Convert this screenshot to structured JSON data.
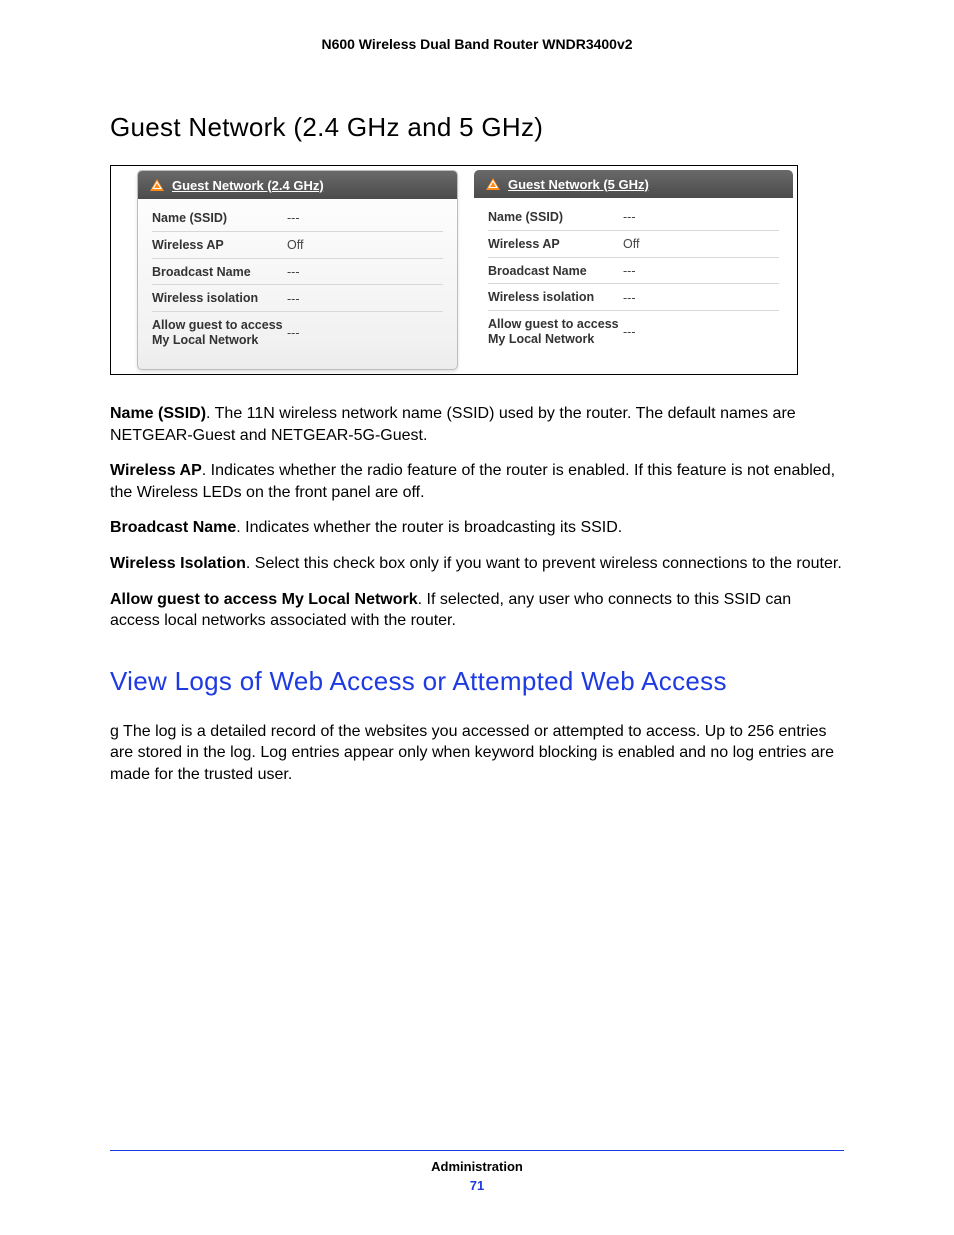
{
  "doc_header": "N600 Wireless Dual Band Router WNDR3400v2",
  "section1_title": "Guest Network (2.4 GHz and 5 GHz)",
  "panels": {
    "left": {
      "title": "Guest Network (2.4 GHz)",
      "rows": [
        {
          "k": "Name (SSID)",
          "v": "---"
        },
        {
          "k": "Wireless AP",
          "v": "Off"
        },
        {
          "k": "Broadcast Name",
          "v": "---"
        },
        {
          "k": "Wireless isolation",
          "v": "---"
        },
        {
          "k": "Allow guest to access My Local Network",
          "v": "---"
        }
      ]
    },
    "right": {
      "title": "Guest Network (5 GHz)",
      "rows": [
        {
          "k": "Name (SSID)",
          "v": "---"
        },
        {
          "k": "Wireless AP",
          "v": "Off"
        },
        {
          "k": "Broadcast Name",
          "v": "---"
        },
        {
          "k": "Wireless isolation",
          "v": "---"
        },
        {
          "k": "Allow guest to access My Local Network",
          "v": "---"
        }
      ]
    }
  },
  "defs": [
    {
      "term": "Name (SSID)",
      "sep": ". ",
      "text": "The 11N wireless network name (SSID) used by the router. The default names are NETGEAR-Guest and NETGEAR-5G-Guest."
    },
    {
      "term": "Wireless AP",
      "sep": ". ",
      "text": "Indicates whether the radio feature of the router is enabled. If this feature is not enabled, the Wireless LEDs on the front panel are off."
    },
    {
      "term": "Broadcast Name",
      "sep": ". ",
      "text": "Indicates whether the router is broadcasting its SSID."
    },
    {
      "term": "Wireless Isolation",
      "sep": ". ",
      "text": "Select this check box only if you want to prevent wireless connections to the router."
    },
    {
      "term": "Allow guest to access My Local Network",
      "sep": ". ",
      "text": "If selected, any user who connects to this SSID can access local networks associated with the router."
    }
  ],
  "section2_title": "View Logs of Web Access or Attempted Web Access",
  "section2_body": " g The log is a detailed record of the websites you accessed or attempted to access. Up to 256 entries are stored in the log. Log entries appear only when keyword blocking is enabled and no log entries are made for the trusted user.",
  "footer_chapter": "Administration",
  "footer_page": "71"
}
